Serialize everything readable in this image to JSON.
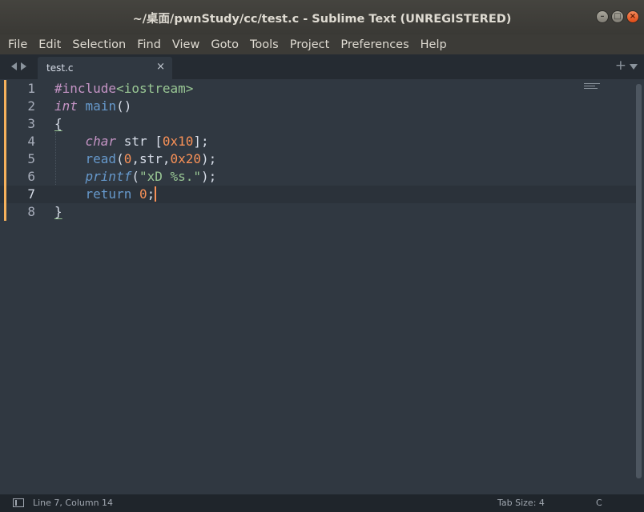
{
  "window": {
    "title": "~/桌面/pwnStudy/cc/test.c - Sublime Text (UNREGISTERED)"
  },
  "menu": [
    "File",
    "Edit",
    "Selection",
    "Find",
    "View",
    "Goto",
    "Tools",
    "Project",
    "Preferences",
    "Help"
  ],
  "tab": {
    "label": "test.c",
    "close": "×",
    "plus": "+"
  },
  "editor": {
    "lines": [
      {
        "n": "1",
        "tokens": [
          {
            "t": "#include",
            "c": "pp"
          },
          {
            "t": "<iostream>",
            "c": "inc"
          }
        ]
      },
      {
        "n": "2",
        "tokens": [
          {
            "t": "int",
            "c": "type"
          },
          {
            "t": " ",
            "c": "plain"
          },
          {
            "t": "main",
            "c": "fn"
          },
          {
            "t": "()",
            "c": "plain"
          }
        ]
      },
      {
        "n": "3",
        "tokens": [
          {
            "t": "{",
            "c": "plain brace"
          }
        ]
      },
      {
        "n": "4",
        "tokens": [
          {
            "t": "    ",
            "c": "plain"
          },
          {
            "t": "char",
            "c": "type"
          },
          {
            "t": " str [",
            "c": "plain"
          },
          {
            "t": "0x10",
            "c": "num"
          },
          {
            "t": "];",
            "c": "plain"
          }
        ]
      },
      {
        "n": "5",
        "tokens": [
          {
            "t": "    ",
            "c": "plain"
          },
          {
            "t": "read",
            "c": "fn"
          },
          {
            "t": "(",
            "c": "plain"
          },
          {
            "t": "0",
            "c": "num"
          },
          {
            "t": ",str,",
            "c": "plain"
          },
          {
            "t": "0x20",
            "c": "num"
          },
          {
            "t": ");",
            "c": "plain"
          }
        ]
      },
      {
        "n": "6",
        "tokens": [
          {
            "t": "    ",
            "c": "plain"
          },
          {
            "t": "printf",
            "c": "fn type"
          },
          {
            "t": "(",
            "c": "plain"
          },
          {
            "t": "\"xD %s.\"",
            "c": "str"
          },
          {
            "t": ");",
            "c": "plain"
          }
        ]
      },
      {
        "n": "7",
        "tokens": [
          {
            "t": "    ",
            "c": "plain"
          },
          {
            "t": "return",
            "c": "fn"
          },
          {
            "t": " ",
            "c": "plain"
          },
          {
            "t": "0",
            "c": "num"
          },
          {
            "t": ";",
            "c": "plain"
          }
        ]
      },
      {
        "n": "8",
        "tokens": [
          {
            "t": "}",
            "c": "plain brace"
          }
        ]
      }
    ],
    "active_line": 7,
    "caret_color": "#f99157"
  },
  "status": {
    "position": "Line 7, Column 14",
    "tab_size": "Tab Size: 4",
    "syntax": "C"
  },
  "colors": {
    "background": "#303841",
    "accent": "#f99157",
    "gutter_modified": "#f6b15c"
  }
}
